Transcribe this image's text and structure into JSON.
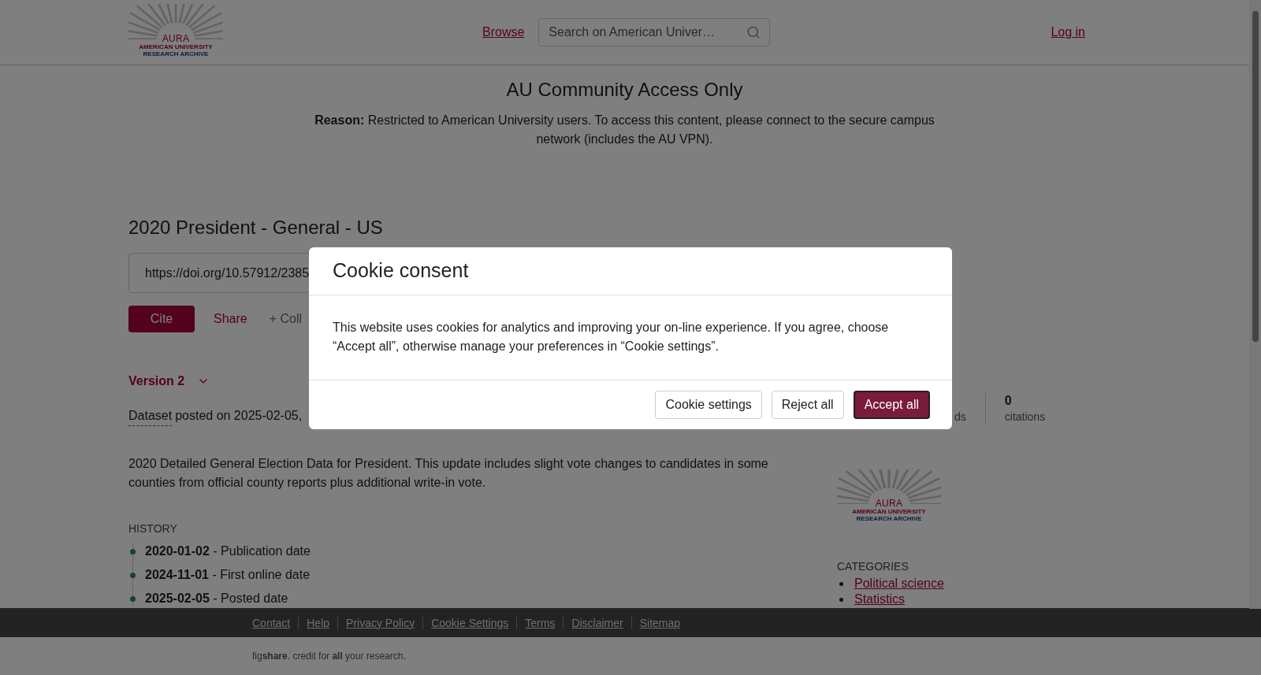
{
  "header": {
    "logo": {
      "name": "AURA",
      "subtitle": [
        "AMERICAN UNIVERSITY",
        "RESEARCH ARCHIVE"
      ]
    },
    "browse": "Browse",
    "search": {
      "placeholder": "Search on American Univer…"
    },
    "login": "Log in"
  },
  "notice": {
    "title": "AU Community Access Only",
    "reason": "**Reason:** Restricted to American University users. To access this content, please connect to the secure campus network (includes the AU VPN)."
  },
  "item": {
    "title": "2020 President - General - US",
    "doi": "https://doi.org/10.57912/2385",
    "actions": [
      {
        "label": "Cite",
        "kind": "primary"
      },
      {
        "label": "Share",
        "kind": "link"
      },
      {
        "label": "+ Coll",
        "kind": "plain"
      }
    ],
    "version": "Version 2",
    "type": "Dataset",
    "posted": "posted on 2025-02-05,",
    "description": "2020 Detailed General Election Data for President. This update includes slight vote changes to candidates in some counties from official county reports plus additional write-in vote.",
    "history_heading": "HISTORY",
    "history": [
      "**2020-01-02** - Publication date",
      "**2024-11-01** - First online date",
      "**2025-02-05** - Posted date"
    ]
  },
  "sidebar": {
    "stats": [
      {
        "label": "ds"
      },
      {
        "value": "0",
        "label": "citations"
      }
    ],
    "logo": {
      "name": "AURA",
      "subtitle": [
        "AMERICAN UNIVERSITY",
        "RESEARCH ARCHIVE"
      ]
    },
    "categories_heading": "CATEGORIES",
    "categories": [
      "Political science",
      "Statistics"
    ]
  },
  "footer": {
    "links": [
      "Contact",
      "Help",
      "Privacy Policy",
      "Cookie Settings",
      "Terms",
      "Disclaimer",
      "Sitemap"
    ],
    "tagline": "fig**share**. credit for **all** your research."
  },
  "modal": {
    "title": "Cookie consent",
    "text": "This website uses cookies for analytics and improving your on-line experience. If you agree, choose “Accept all”, otherwise manage your preferences in “Cookie settings”.",
    "buttons": [
      {
        "label": "Cookie settings",
        "kind": "secondary"
      },
      {
        "label": "Reject all",
        "kind": "secondary"
      },
      {
        "label": "Accept all",
        "kind": "primary"
      }
    ]
  }
}
